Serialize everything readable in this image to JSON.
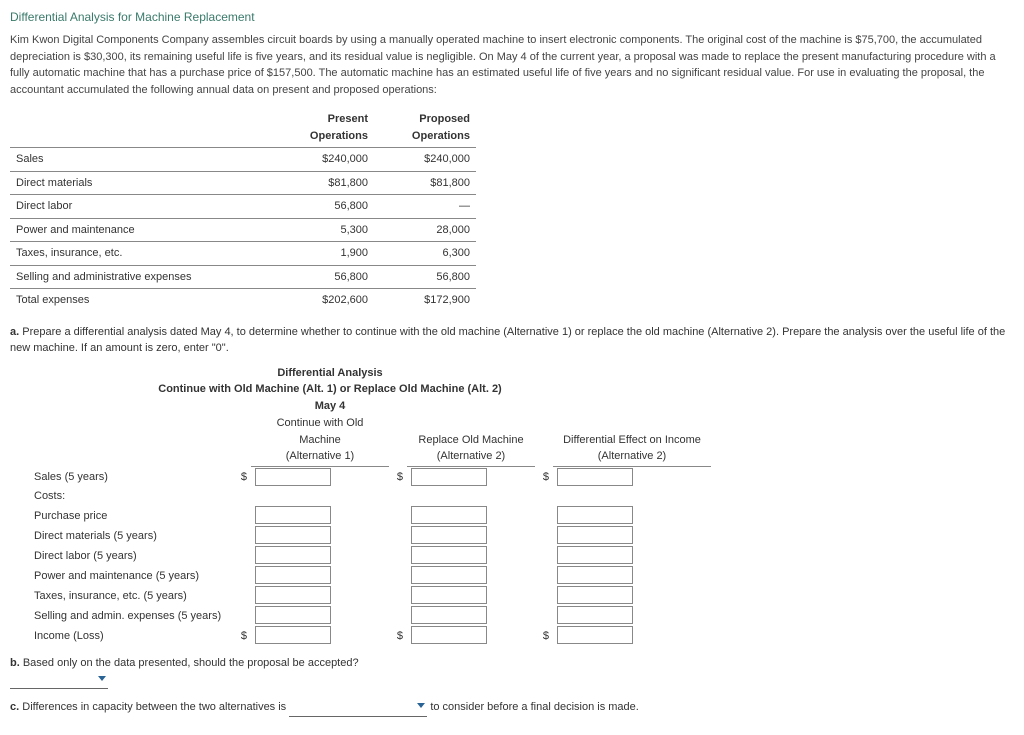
{
  "title": "Differential Analysis for Machine Replacement",
  "intro": "Kim Kwon Digital Components Company assembles circuit boards by using a manually operated machine to insert electronic components. The original cost of the machine is $75,700, the accumulated depreciation is $30,300, its remaining useful life is five years, and its residual value is negligible. On May 4 of the current year, a proposal was made to replace the present manufacturing procedure with a fully automatic machine that has a purchase price of $157,500. The automatic machine has an estimated useful life of five years and no significant residual value. For use in evaluating the proposal, the accountant accumulated the following annual data on present and proposed operations:",
  "t1": {
    "h1": "Present Operations",
    "h2": "Proposed Operations",
    "rows": [
      {
        "l": "Sales",
        "a": "$240,000",
        "b": "$240,000"
      },
      {
        "l": "Direct materials",
        "a": "$81,800",
        "b": "$81,800"
      },
      {
        "l": "Direct labor",
        "a": "56,800",
        "b": "—"
      },
      {
        "l": "Power and maintenance",
        "a": "5,300",
        "b": "28,000"
      },
      {
        "l": "Taxes, insurance, etc.",
        "a": "1,900",
        "b": "6,300"
      },
      {
        "l": "Selling and administrative expenses",
        "a": "56,800",
        "b": "56,800"
      },
      {
        "l": "Total expenses",
        "a": "$202,600",
        "b": "$172,900"
      }
    ]
  },
  "qa": {
    "letter": "a.",
    "text": "Prepare a differential analysis dated May 4, to determine whether to continue with the old machine (Alternative 1) or replace the old machine (Alternative 2). Prepare the analysis over the useful life of the new machine. If an amount is zero, enter \"0\"."
  },
  "da": {
    "title1": "Differential Analysis",
    "title2": "Continue with Old Machine (Alt. 1) or Replace Old Machine (Alt. 2)",
    "title3": "May 4",
    "c1a": "Continue with Old Machine",
    "c1b": "(Alternative 1)",
    "c2a": "Replace Old Machine",
    "c2b": "(Alternative 2)",
    "c3a": "Differential Effect on Income",
    "c3b": "(Alternative 2)",
    "rows": [
      "Sales (5 years)",
      "Costs:",
      "Purchase price",
      "Direct materials (5 years)",
      "Direct labor (5 years)",
      "Power and maintenance (5 years)",
      "Taxes, insurance, etc. (5 years)",
      "Selling and admin. expenses (5 years)",
      "Income (Loss)"
    ]
  },
  "qb": {
    "letter": "b.",
    "text": "Based only on the data presented, should the proposal be accepted?"
  },
  "qc": {
    "letter": "c.",
    "pre": "Differences in capacity between the two alternatives is",
    "post": "to consider before a final decision is made."
  }
}
